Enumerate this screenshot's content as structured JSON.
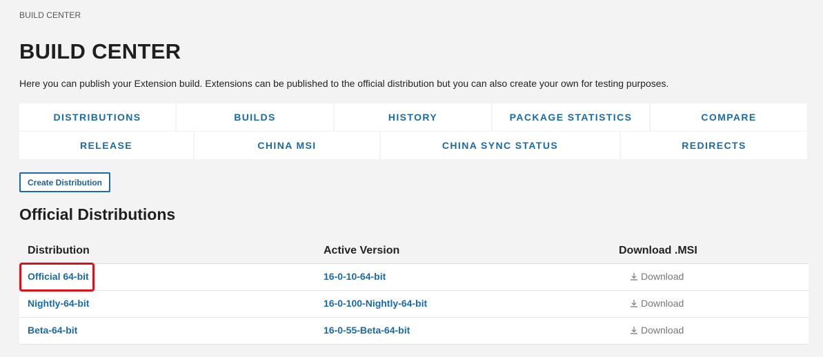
{
  "breadcrumb": "BUILD CENTER",
  "page_title": "BUILD CENTER",
  "description": "Here you can publish your Extension build. Extensions can be published to the official distribution but you can also create your own for testing purposes.",
  "nav": {
    "row1": [
      "DISTRIBUTIONS",
      "BUILDS",
      "HISTORY",
      "PACKAGE STATISTICS",
      "COMPARE"
    ],
    "row2": [
      "RELEASE",
      "CHINA MSI",
      "CHINA SYNC STATUS",
      "REDIRECTS"
    ]
  },
  "create_button": "Create Distribution",
  "section_title": "Official Distributions",
  "table": {
    "headers": [
      "Distribution",
      "Active Version",
      "Download .MSI"
    ],
    "rows": [
      {
        "distribution": "Official 64-bit",
        "version": "16-0-10-64-bit",
        "download": "Download"
      },
      {
        "distribution": "Nightly-64-bit",
        "version": "16-0-100-Nightly-64-bit",
        "download": "Download"
      },
      {
        "distribution": "Beta-64-bit",
        "version": "16-0-55-Beta-64-bit",
        "download": "Download"
      }
    ]
  },
  "colors": {
    "accent": "#1a6aa8",
    "background": "#f3f3f3",
    "highlight": "#e0101a"
  },
  "icons": {
    "download": "download-icon"
  }
}
